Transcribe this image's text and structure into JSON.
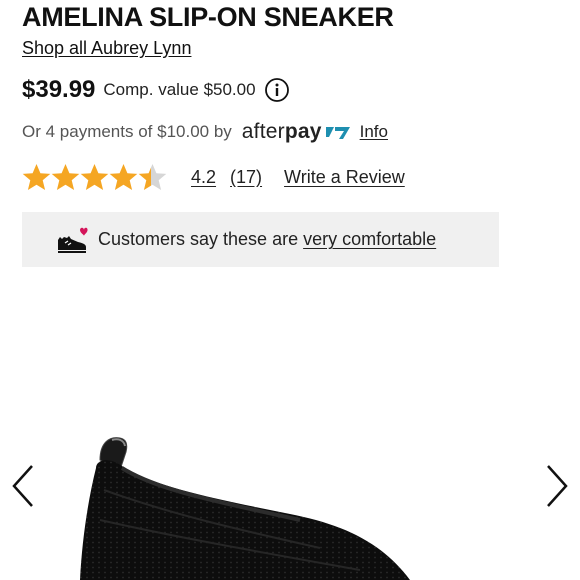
{
  "product": {
    "title": "AMELINA SLIP-ON SNEAKER",
    "shop_all_label": "Shop all Aubrey Lynn"
  },
  "pricing": {
    "price": "$39.99",
    "comp_value": "Comp. value $50.00",
    "info_icon": "info-circle-icon"
  },
  "afterpay": {
    "payments_text": "Or 4 payments of $10.00 by",
    "logo_text_light": "after",
    "logo_text_bold": "pay",
    "info_label": "Info",
    "brand_color": "#1e8fb0"
  },
  "rating": {
    "stars_value": 4.2,
    "stars_max": 5,
    "star_color": "#f5a623",
    "star_empty_color": "#d6d6d6",
    "average": "4.2",
    "count": "(17)",
    "write_review_label": "Write a Review"
  },
  "banner": {
    "icon": "shoe-heart-icon",
    "text": "Customers say these are",
    "link": "very comfortable",
    "heart_color": "#d4145a",
    "background": "#f0f0f0"
  },
  "carousel": {
    "prev_icon": "chevron-left-icon",
    "next_icon": "chevron-right-icon"
  }
}
